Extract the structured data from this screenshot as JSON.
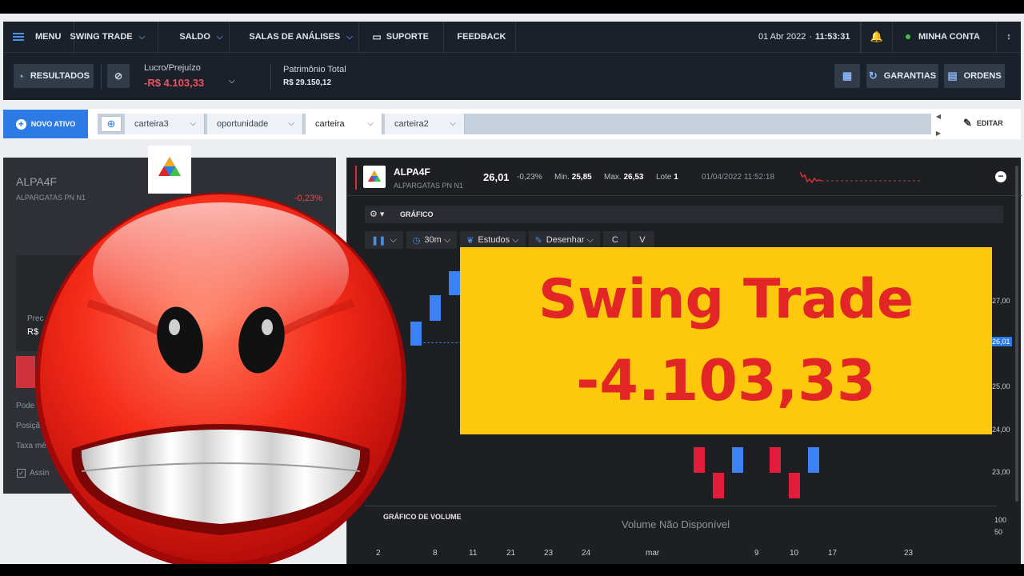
{
  "topnav": {
    "menu_label": "MENU",
    "swing_trade_label": "SWING TRADE",
    "saldo_label": "SALDO",
    "salas_label": "SALAS DE ANÁLISES",
    "suporte_label": "SUPORTE",
    "feedback_label": "FEEDBACK",
    "date": "01 Abr 2022",
    "time": "11:53:31",
    "account_label": "MINHA CONTA"
  },
  "subheader": {
    "resultados_label": "RESULTADOS",
    "lucro_label": "Lucro/Prejuízo",
    "lucro_value": "-R$ 4.103,33",
    "patrimonio_label": "Patrimônio Total",
    "patrimonio_value": "R$ 29.150,12",
    "garantias_label": "GARANTIAS",
    "ordens_label": "ORDENS"
  },
  "portfolio": {
    "novo_ativo_label": "NOVO ATIVO",
    "tabs": [
      {
        "label": "carteira3"
      },
      {
        "label": "oportunidade"
      },
      {
        "label": "carteira"
      },
      {
        "label": "carteira2"
      }
    ],
    "editar_label": "EDITAR"
  },
  "left_panel": {
    "ticker": "ALPA4F",
    "name": "ALPARGATAS PN N1",
    "change_pct": "-0,23%",
    "price_label_partial": "Prec",
    "price_value_partial": "R$",
    "rows": [
      "Pode",
      "Posiçã",
      "Taxa méd"
    ],
    "checkbox_label_partial": "Assin"
  },
  "chart_panel": {
    "ticker": "ALPA4F",
    "name": "ALPARGATAS PN N1",
    "price": "26,01",
    "change_pct": "-0,23%",
    "min_label": "Min.",
    "min_value": "25,85",
    "max_label": "Max.",
    "max_value": "26,53",
    "lote_label": "Lote",
    "lote_value": "1",
    "timestamp": "01/04/2022  11:52:18",
    "grafico_label": "GRÁFICO",
    "toolbar": {
      "interval": "30m",
      "estudos": "Estudos",
      "desenhar": "Desenhar",
      "c": "C",
      "v": "V"
    },
    "y_ticks": [
      "27,00",
      "25,00",
      "24,00",
      "23,00"
    ],
    "current_price_tag": "26,01",
    "volume_label": "GRÁFICO DE VOLUME",
    "volume_na": "Volume Não Disponível",
    "volume_ticks": [
      "100",
      "50"
    ],
    "x_ticks": [
      "2",
      "8",
      "11",
      "21",
      "23",
      "24",
      "mar",
      "9",
      "10",
      "17",
      "23"
    ]
  },
  "banner": {
    "title": "Swing Trade",
    "value": "-4.103,33"
  },
  "colors": {
    "nav_bg": "#1b212b",
    "accent_blue": "#2c7be5",
    "loss_red": "#f0525c",
    "banner_yellow": "#fec90d",
    "banner_text": "#e22626"
  }
}
